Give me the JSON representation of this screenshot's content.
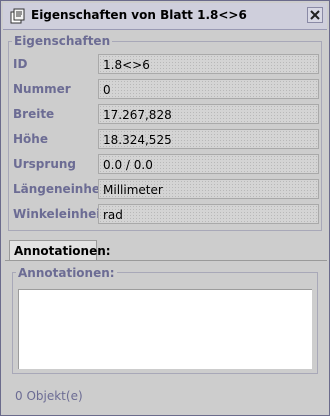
{
  "window": {
    "title": "Eigenschaften von Blatt 1.8<>6"
  },
  "properties": {
    "group_title": "Eigenschaften",
    "rows": [
      {
        "label": "ID",
        "value": "1.8<>6"
      },
      {
        "label": "Nummer",
        "value": "0"
      },
      {
        "label": "Breite",
        "value": "17.267,828"
      },
      {
        "label": "Höhe",
        "value": "18.324,525"
      },
      {
        "label": "Ursprung",
        "value": "0.0 / 0.0"
      },
      {
        "label": "Längeneinheit",
        "value": "Millimeter"
      },
      {
        "label": "Winkeleinheit",
        "value": "rad"
      }
    ]
  },
  "annotations": {
    "tab_label": "Annotationen:",
    "group_title": "Annotationen:",
    "count_text": "0 Objekt(e)"
  },
  "colors": {
    "accent_label": "#6c6c94",
    "window_bg": "#cdcdcd",
    "field_bg": "#d4d4d4"
  },
  "icons": {
    "title": "properties-icon",
    "close": "close-icon"
  }
}
